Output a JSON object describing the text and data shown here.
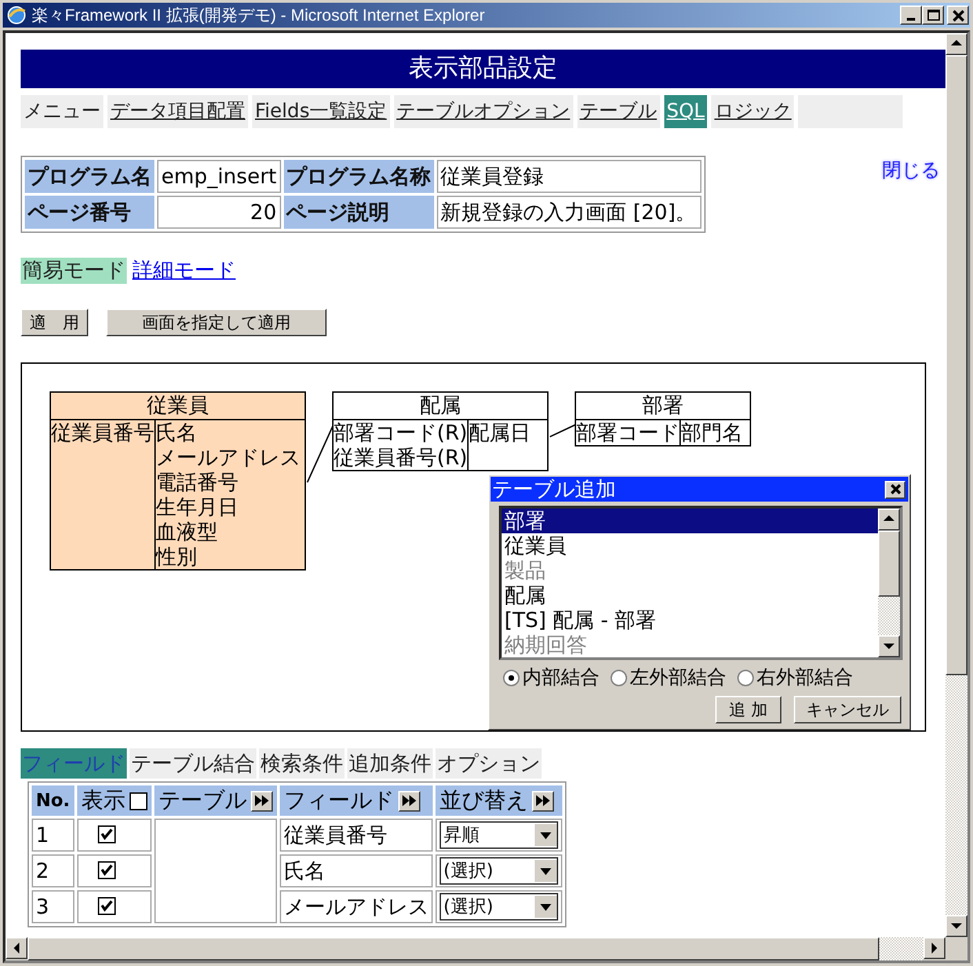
{
  "window": {
    "title": "楽々Framework II 拡張(開発デモ) - Microsoft Internet Explorer"
  },
  "page": {
    "header": "表示部品設定",
    "tabs": [
      {
        "label": "メニュー",
        "kind": "text",
        "selected": false
      },
      {
        "label": "データ項目配置",
        "kind": "link",
        "selected": false
      },
      {
        "label": "Fields一覧設定",
        "kind": "link",
        "selected": false
      },
      {
        "label": "テーブルオプション",
        "kind": "link",
        "selected": false
      },
      {
        "label": "テーブル",
        "kind": "link",
        "selected": false
      },
      {
        "label": "SQL",
        "kind": "link",
        "selected": true
      },
      {
        "label": "ロジック",
        "kind": "link",
        "selected": false
      }
    ],
    "info": [
      [
        {
          "label": "プログラム名",
          "value": "emp_insert",
          "kind": "text"
        },
        {
          "label": "プログラム名称",
          "value": "従業員登録",
          "kind": "text"
        }
      ],
      [
        {
          "label": "ページ番号",
          "value": "20",
          "kind": "number"
        },
        {
          "label": "ページ説明",
          "value": "新規登録の入力画面 [20]。",
          "kind": "text"
        }
      ]
    ],
    "close_link": "閉じる",
    "modes": [
      {
        "label": "簡易モード",
        "selected": true
      },
      {
        "label": "詳細モード",
        "selected": false
      }
    ],
    "buttons": [
      "適　用",
      "画面を指定して適用"
    ],
    "diagram": {
      "entities": [
        {
          "name": "従業員",
          "selected": true,
          "keys": [
            "従業員番号"
          ],
          "fields": [
            "氏名",
            "メールアドレス",
            "電話番号",
            "生年月日",
            "血液型",
            "性別"
          ]
        },
        {
          "name": "配属",
          "selected": false,
          "keys": [
            "部署コード(R)",
            "従業員番号(R)"
          ],
          "fields": [
            "配属日"
          ]
        },
        {
          "name": "部署",
          "selected": false,
          "keys": [
            "部署コード"
          ],
          "fields": [
            "部門名"
          ]
        }
      ],
      "dialog": {
        "title": "テーブル追加",
        "items": [
          {
            "label": "部署",
            "selected": true,
            "disabled": false
          },
          {
            "label": "従業員",
            "selected": false,
            "disabled": false
          },
          {
            "label": "製品",
            "selected": false,
            "disabled": true
          },
          {
            "label": "配属",
            "selected": false,
            "disabled": false
          },
          {
            "label": "[TS] 配属 - 部署",
            "selected": false,
            "disabled": false
          },
          {
            "label": "納期回答",
            "selected": false,
            "disabled": true
          }
        ],
        "join_types": [
          {
            "label": "内部結合",
            "selected": true
          },
          {
            "label": "左外部結合",
            "selected": false
          },
          {
            "label": "右外部結合",
            "selected": false
          }
        ],
        "buttons": [
          "追 加",
          "キャンセル"
        ]
      }
    },
    "sql_tabs": [
      {
        "label": "フィールド",
        "selected": true
      },
      {
        "label": "テーブル結合",
        "selected": false
      },
      {
        "label": "検索条件",
        "selected": false
      },
      {
        "label": "追加条件",
        "selected": false
      },
      {
        "label": "オプション",
        "selected": false
      }
    ],
    "fields_table": {
      "columns": [
        {
          "label": "No.",
          "kind": "plain"
        },
        {
          "label": "表示",
          "kind": "checkbox",
          "checked": false
        },
        {
          "label": "テーブル",
          "kind": "expand"
        },
        {
          "label": "フィールド",
          "kind": "expand"
        },
        {
          "label": "並び替え",
          "kind": "expand"
        }
      ],
      "rows": [
        {
          "no": "1",
          "shown": true,
          "field": "従業員番号",
          "sort": "昇順"
        },
        {
          "no": "2",
          "shown": true,
          "field": "氏名",
          "sort": "(選択)"
        },
        {
          "no": "3",
          "shown": true,
          "field": "メールアドレス",
          "sort": "(選択)"
        }
      ]
    }
  }
}
